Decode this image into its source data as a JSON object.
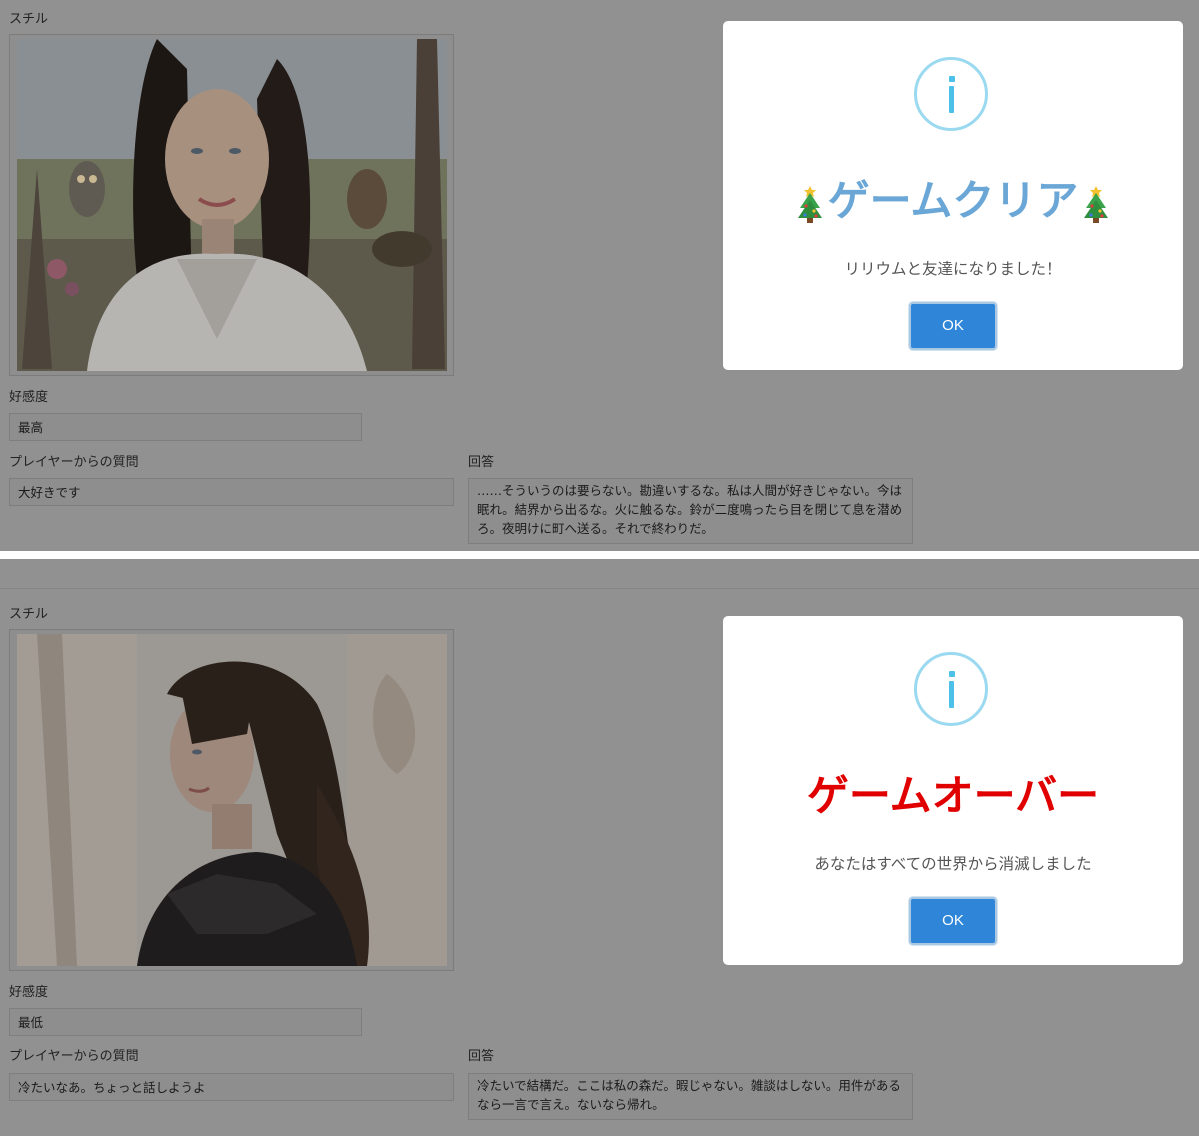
{
  "panels": [
    {
      "still_label": "スチル",
      "affinity_label": "好感度",
      "affinity_value": "最高",
      "question_label": "プレイヤーからの質問",
      "question_value": "大好きです",
      "answer_label": "回答",
      "answer_value": "……そういうのは要らない。勘違いするな。私は人間が好きじゃない。今は眠れ。結界から出るな。火に触るな。鈴が二度鳴ったら目を閉じて息を潜めろ。夜明けに町へ送る。それで終わりだ。",
      "modal": {
        "icon": "info-icon",
        "title": "ゲームクリア",
        "title_color": "#6aa7d6",
        "decoration_icon": "christmas-tree-icon",
        "message": "リリウムと友達になりました！",
        "ok_label": "OK"
      }
    },
    {
      "still_label": "スチル",
      "affinity_label": "好感度",
      "affinity_value": "最低",
      "question_label": "プレイヤーからの質問",
      "question_value": "冷たいなあ。ちょっと話しようよ",
      "answer_label": "回答",
      "answer_value": "冷たいで結構だ。ここは私の森だ。暇じゃない。雑談はしない。用件があるなら一言で言え。ないなら帰れ。",
      "modal": {
        "icon": "info-icon",
        "title": "ゲームオーバー",
        "title_color": "#e00000",
        "message": "あなたはすべての世界から消滅しました",
        "ok_label": "OK"
      }
    }
  ],
  "colors": {
    "overlay": "#919191",
    "button": "#2f86d8",
    "info_icon": "#4dc0ea"
  }
}
